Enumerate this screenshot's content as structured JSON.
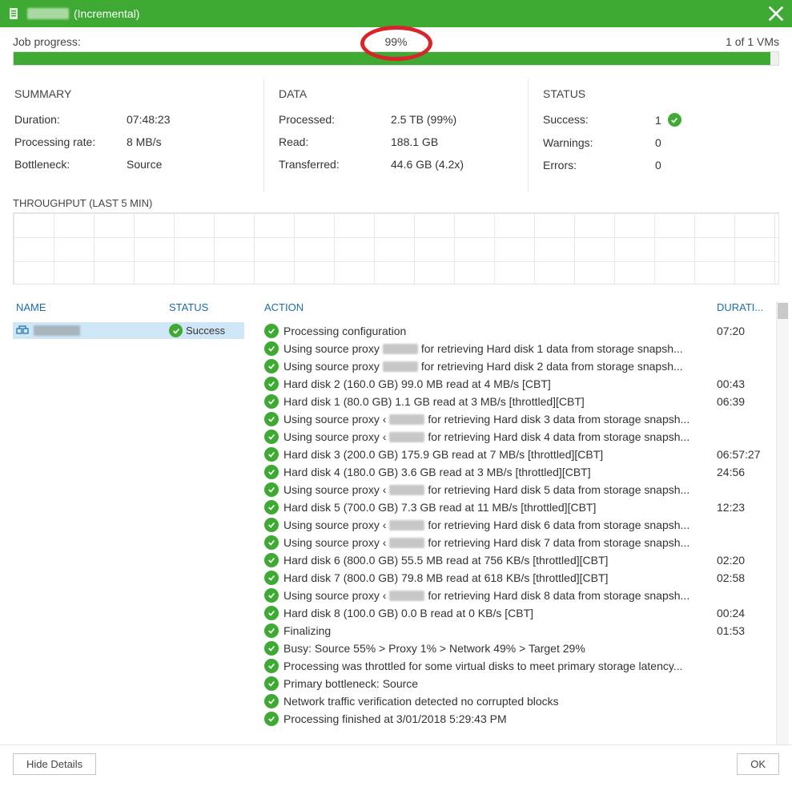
{
  "titlebar": {
    "suffix": "(Incremental)"
  },
  "progress": {
    "label": "Job progress:",
    "percent": "99%",
    "vm_count": "1 of 1 VMs"
  },
  "summary": {
    "heading": "SUMMARY",
    "duration_lbl": "Duration:",
    "duration_val": "07:48:23",
    "rate_lbl": "Processing rate:",
    "rate_val": "8 MB/s",
    "bottleneck_lbl": "Bottleneck:",
    "bottleneck_val": "Source"
  },
  "data": {
    "heading": "DATA",
    "processed_lbl": "Processed:",
    "processed_val": "2.5 TB (99%)",
    "read_lbl": "Read:",
    "read_val": "188.1 GB",
    "transferred_lbl": "Transferred:",
    "transferred_val": "44.6 GB (4.2x)"
  },
  "status": {
    "heading": "STATUS",
    "success_lbl": "Success:",
    "success_val": "1",
    "warnings_lbl": "Warnings:",
    "warnings_val": "0",
    "errors_lbl": "Errors:",
    "errors_val": "0"
  },
  "throughput": {
    "label": "THROUGHPUT (LAST 5 MIN)"
  },
  "vm_list": {
    "col_name": "NAME",
    "col_status": "STATUS",
    "items": [
      {
        "status": "Success"
      }
    ]
  },
  "action_list": {
    "col_action": "ACTION",
    "col_duration": "DURATI...",
    "items": [
      {
        "text_pre": "Processing configuration",
        "text_post": "",
        "proxy": false,
        "duration": "07:20"
      },
      {
        "text_pre": "Using source proxy",
        "text_post": "for retrieving Hard disk 1 data from storage snapsh...",
        "proxy": true,
        "duration": ""
      },
      {
        "text_pre": "Using source proxy",
        "text_post": "for retrieving Hard disk 2 data from storage snapsh...",
        "proxy": true,
        "duration": ""
      },
      {
        "text_pre": "Hard disk 2 (160.0 GB) 99.0 MB read at 4 MB/s [CBT]",
        "text_post": "",
        "proxy": false,
        "duration": "00:43"
      },
      {
        "text_pre": "Hard disk 1 (80.0 GB) 1.1 GB read at 3 MB/s [throttled][CBT]",
        "text_post": "",
        "proxy": false,
        "duration": "06:39"
      },
      {
        "text_pre": "Using source proxy ‹",
        "text_post": "for retrieving Hard disk 3 data from storage snapsh...",
        "proxy": true,
        "duration": ""
      },
      {
        "text_pre": "Using source proxy ‹",
        "text_post": "for retrieving Hard disk 4 data from storage snapsh...",
        "proxy": true,
        "duration": ""
      },
      {
        "text_pre": "Hard disk 3 (200.0 GB) 175.9 GB read at 7 MB/s [throttled][CBT]",
        "text_post": "",
        "proxy": false,
        "duration": "06:57:27"
      },
      {
        "text_pre": "Hard disk 4 (180.0 GB) 3.6 GB read at 3 MB/s [throttled][CBT]",
        "text_post": "",
        "proxy": false,
        "duration": "24:56"
      },
      {
        "text_pre": "Using source proxy ‹",
        "text_post": "for retrieving Hard disk 5 data from storage snapsh...",
        "proxy": true,
        "duration": ""
      },
      {
        "text_pre": "Hard disk 5 (700.0 GB) 7.3 GB read at 11 MB/s [throttled][CBT]",
        "text_post": "",
        "proxy": false,
        "duration": "12:23"
      },
      {
        "text_pre": "Using source proxy ‹",
        "text_post": "for retrieving Hard disk 6 data from storage snapsh...",
        "proxy": true,
        "duration": ""
      },
      {
        "text_pre": "Using source proxy ‹",
        "text_post": "for retrieving Hard disk 7 data from storage snapsh...",
        "proxy": true,
        "duration": ""
      },
      {
        "text_pre": "Hard disk 6 (800.0 GB) 55.5 MB read at 756 KB/s [throttled][CBT]",
        "text_post": "",
        "proxy": false,
        "duration": "02:20"
      },
      {
        "text_pre": "Hard disk 7 (800.0 GB) 79.8 MB read at 618 KB/s [throttled][CBT]",
        "text_post": "",
        "proxy": false,
        "duration": "02:58"
      },
      {
        "text_pre": "Using source proxy ‹",
        "text_post": "for retrieving Hard disk 8 data from storage snapsh...",
        "proxy": true,
        "duration": ""
      },
      {
        "text_pre": "Hard disk 8 (100.0 GB) 0.0 B read at 0 KB/s [CBT]",
        "text_post": "",
        "proxy": false,
        "duration": "00:24"
      },
      {
        "text_pre": "Finalizing",
        "text_post": "",
        "proxy": false,
        "duration": "01:53"
      },
      {
        "text_pre": "Busy: Source 55% > Proxy 1% > Network 49% > Target 29%",
        "text_post": "",
        "proxy": false,
        "duration": ""
      },
      {
        "text_pre": "Processing was throttled for some virtual disks to meet primary storage latency...",
        "text_post": "",
        "proxy": false,
        "duration": ""
      },
      {
        "text_pre": "Primary bottleneck: Source",
        "text_post": "",
        "proxy": false,
        "duration": ""
      },
      {
        "text_pre": "Network traffic verification detected no corrupted blocks",
        "text_post": "",
        "proxy": false,
        "duration": ""
      },
      {
        "text_pre": "Processing finished at 3/01/2018 5:29:43 PM",
        "text_post": "",
        "proxy": false,
        "duration": ""
      }
    ]
  },
  "footer": {
    "hide_details": "Hide Details",
    "ok": "OK"
  }
}
